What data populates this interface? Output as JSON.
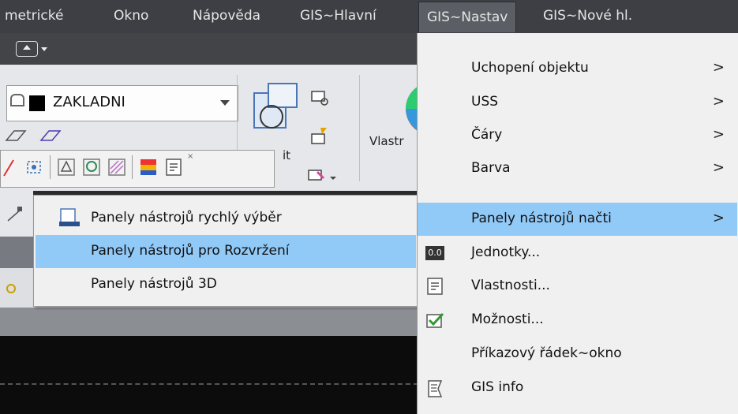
{
  "menubar": {
    "items": [
      {
        "label": "metrické"
      },
      {
        "label": "Okno"
      },
      {
        "label": "Nápověda"
      },
      {
        "label": "GIS~Hlavní"
      },
      {
        "label": "GIS~Nastav"
      },
      {
        "label": "GIS~Nové hl."
      }
    ]
  },
  "ribbon": {
    "layer_combo": {
      "value": "ZAKLADNI"
    },
    "vlastnosti_partial": "Vlastr"
  },
  "submenu": {
    "items": [
      {
        "label": "Panely nástrojů rychlý výběr",
        "icon": "toolbar-icon"
      },
      {
        "label": "Panely nástrojů pro Rozvržení",
        "highlighted": true
      },
      {
        "label": "Panely nástrojů 3D"
      }
    ]
  },
  "main_menu": {
    "items": [
      {
        "label": "Uchopení objektu",
        "has_submenu": true
      },
      {
        "label": "USS",
        "has_submenu": true
      },
      {
        "label": "Čáry",
        "has_submenu": true
      },
      {
        "label": "Barva",
        "has_submenu": true
      },
      {
        "label": "Panely nástrojů načti",
        "has_submenu": true,
        "highlighted": true
      },
      {
        "label": "Jednotky...",
        "icon": "units-icon"
      },
      {
        "label": "Vlastnosti...",
        "icon": "properties-icon"
      },
      {
        "label": "Možnosti...",
        "icon": "options-check-icon"
      },
      {
        "label": "Příkazový řádek~okno"
      },
      {
        "label": "GIS info",
        "icon": "gis-info-icon"
      }
    ],
    "chevron": ">",
    "units_icon_text": "0.0"
  },
  "colors": {
    "menubar_bg": "#3d3f44",
    "highlight": "#91c9f7",
    "menu_bg": "#f0f0f0"
  }
}
